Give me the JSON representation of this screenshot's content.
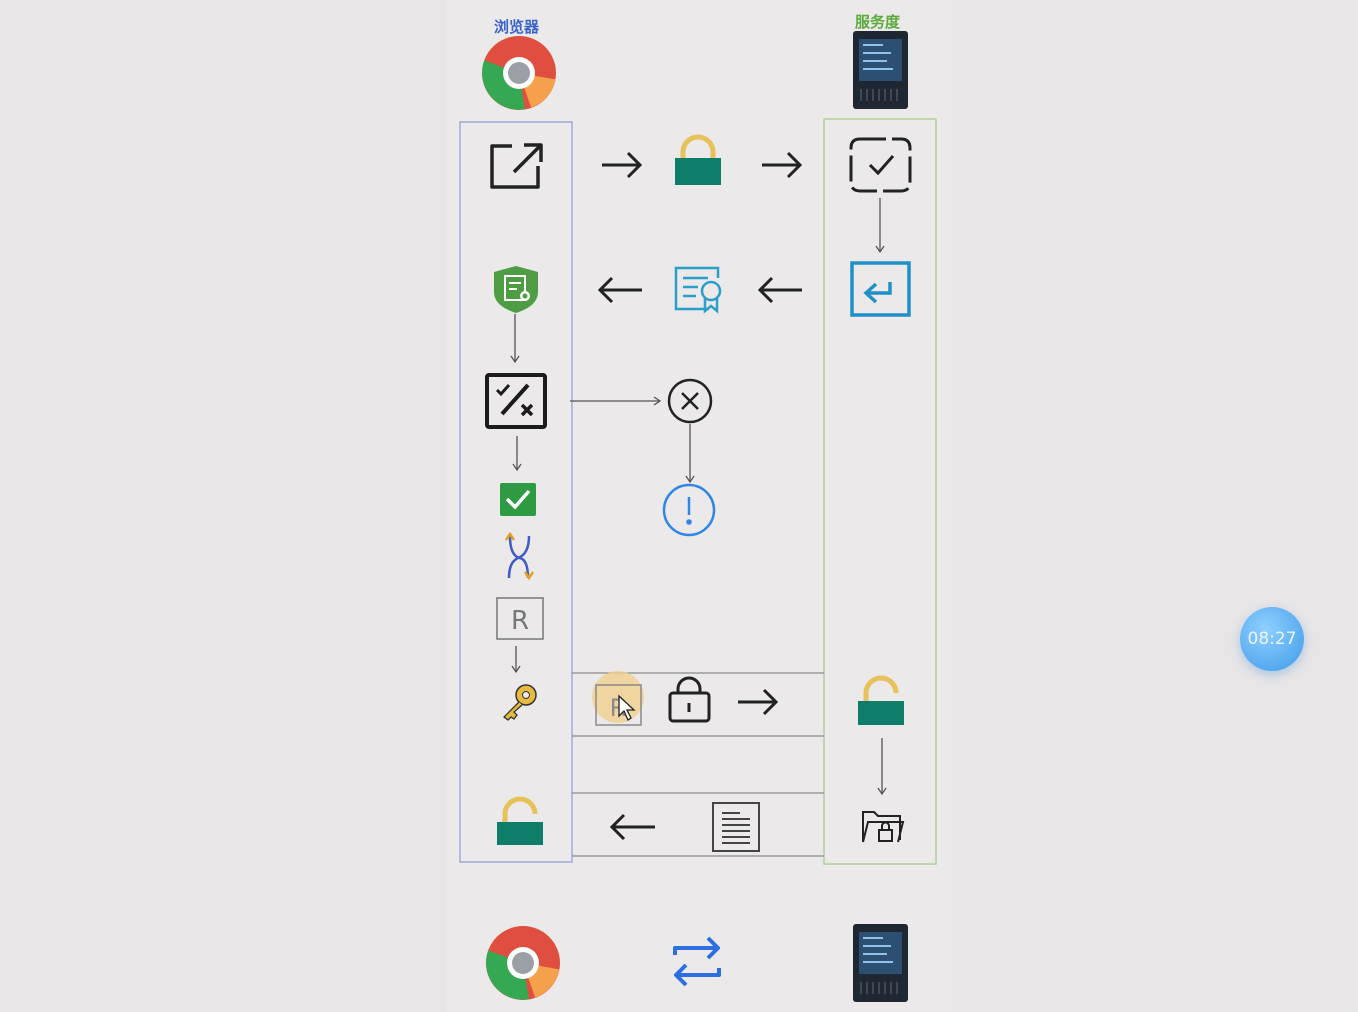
{
  "labels": {
    "browser": "浏览器",
    "server": "服务度"
  },
  "timer": {
    "text": "08:27"
  },
  "colors": {
    "browser_label": "#3b64c9",
    "server_label": "#5cab3c",
    "lock_green": "#0e7d6a",
    "lock_yellow": "#e7c15a",
    "cert_blue": "#2aa0c8",
    "alert_blue": "#2f86e6",
    "check_green": "#2e9a43"
  },
  "icons": [
    "chrome-icon",
    "server-icon",
    "external-link-icon",
    "padlock-icon",
    "verify-check-icon",
    "return-icon",
    "shield-document-icon",
    "certificate-icon",
    "validate-icon",
    "error-circle-icon",
    "warning-circle-icon",
    "check-box-icon",
    "swap-arrows-icon",
    "random-r-icon",
    "key-icon",
    "open-lock-icon",
    "document-icon",
    "folder-lock-icon",
    "exchange-arrows-icon",
    "cursor-icon"
  ]
}
